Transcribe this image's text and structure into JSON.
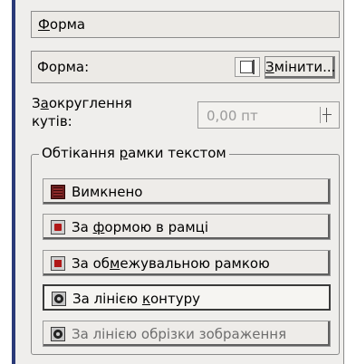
{
  "section": {
    "label_pre": "",
    "label_u": "Ф",
    "label_post": "орма"
  },
  "shape": {
    "label": "Форма:",
    "icon": "shape-picker-icon",
    "change_pre": "",
    "change_u": "З",
    "change_post": "мінити..."
  },
  "rounding": {
    "label_line1_pre": "З",
    "label_line1_u": "а",
    "label_line1_post": "округлення",
    "label_line2": "кутів:",
    "value": "0,00 пт"
  },
  "wrap": {
    "title_pre": "Обтікання ",
    "title_u": "р",
    "title_post": "амки текстом",
    "options": [
      {
        "pre": "Вимкнено",
        "u": "",
        "post": "",
        "icon": "wrap-off-icon",
        "state": "normal"
      },
      {
        "pre": "За ",
        "u": "ф",
        "post": "ормою в рамці",
        "icon": "wrap-shape-icon",
        "state": "normal"
      },
      {
        "pre": "За об",
        "u": "м",
        "post": "ежувальною рамкою",
        "icon": "wrap-bounding-icon",
        "state": "normal"
      },
      {
        "pre": "За лінією ",
        "u": "к",
        "post": "онтуру",
        "icon": "wrap-contour-icon",
        "state": "selected"
      },
      {
        "pre": "За лінією обрізки зображення",
        "u": "",
        "post": "",
        "icon": "wrap-crop-contour-icon",
        "state": "dimmed"
      }
    ]
  },
  "colors": {
    "panel_bg": "#efeeec",
    "frame_accent": "#2a3a78",
    "disabled_text": "#6e6e6e"
  }
}
